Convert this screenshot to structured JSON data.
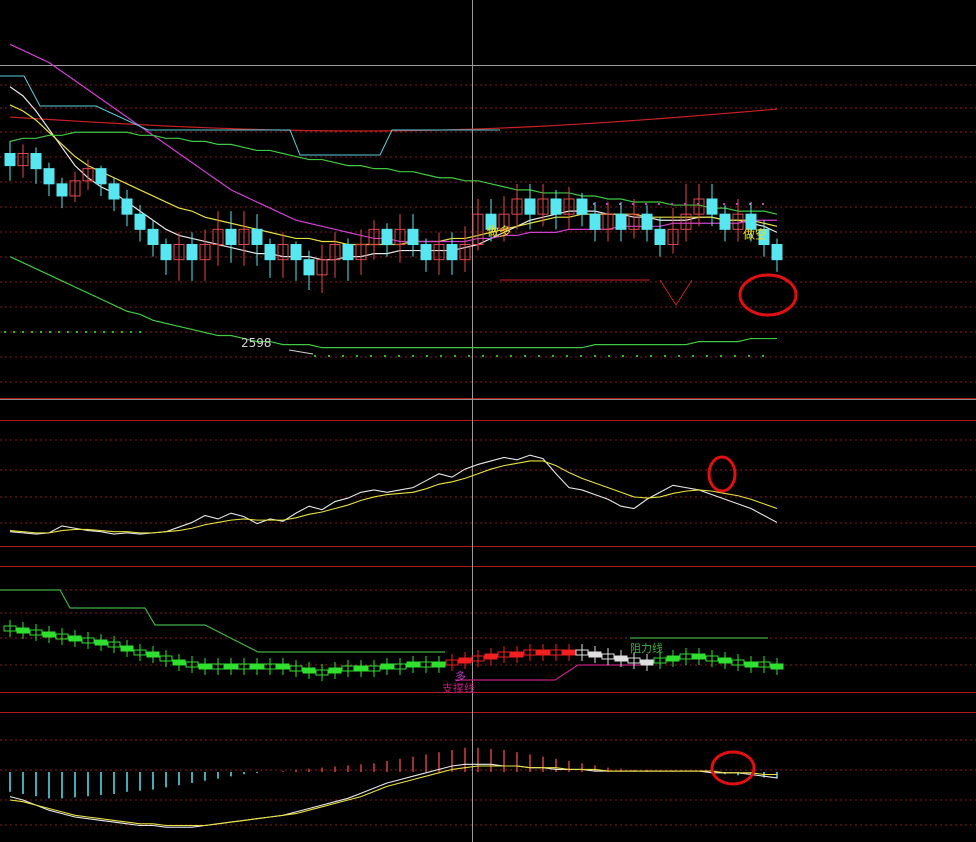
{
  "colors": {
    "background": "#000000",
    "grid_dotted": "#8a1a1a",
    "panel_border": "#b01818",
    "crosshair": "#9a9a9a",
    "bull_candle": "#e04848",
    "bear_candle": "#58e6f0",
    "ma_white": "#e8e8e8",
    "ma_yellow": "#e8e040",
    "ma_magenta": "#d040d0",
    "ma_green": "#40c840",
    "band_red": "#c82020",
    "dot_green": "#20c020",
    "dot_magenta": "#c040c0",
    "label_yellow": "#f0e020",
    "label_white": "#d0d0d0",
    "circle_red": "#e01010",
    "block_green": "#30e030",
    "block_red": "#f02020",
    "block_white": "#e0e0e0",
    "resist_green": "#40b040",
    "support_magenta": "#c02080",
    "hist_cyan": "#58e6f0",
    "hist_red": "#d04040"
  },
  "chart_data": [
    {
      "id": "main",
      "type": "candlestick",
      "annotations": [
        {
          "text": "做多",
          "series_index": 37
        },
        {
          "text": "做空",
          "series_index": 57
        },
        {
          "text": "2598",
          "series_index": 17
        }
      ],
      "candles": [
        {
          "o": 74,
          "c": 70,
          "h": 78,
          "l": 65
        },
        {
          "o": 70,
          "c": 74,
          "h": 77,
          "l": 66
        },
        {
          "o": 74,
          "c": 69,
          "h": 76,
          "l": 64
        },
        {
          "o": 69,
          "c": 64,
          "h": 71,
          "l": 60
        },
        {
          "o": 64,
          "c": 60,
          "h": 66,
          "l": 56
        },
        {
          "o": 60,
          "c": 65,
          "h": 68,
          "l": 58
        },
        {
          "o": 65,
          "c": 69,
          "h": 72,
          "l": 62
        },
        {
          "o": 69,
          "c": 64,
          "h": 70,
          "l": 60
        },
        {
          "o": 64,
          "c": 59,
          "h": 66,
          "l": 55
        },
        {
          "o": 59,
          "c": 54,
          "h": 62,
          "l": 50
        },
        {
          "o": 54,
          "c": 49,
          "h": 57,
          "l": 45
        },
        {
          "o": 49,
          "c": 44,
          "h": 52,
          "l": 40
        },
        {
          "o": 44,
          "c": 39,
          "h": 46,
          "l": 34
        },
        {
          "o": 39,
          "c": 44,
          "h": 48,
          "l": 32
        },
        {
          "o": 44,
          "c": 39,
          "h": 48,
          "l": 32
        },
        {
          "o": 39,
          "c": 44,
          "h": 49,
          "l": 32
        },
        {
          "o": 44,
          "c": 49,
          "h": 55,
          "l": 37
        },
        {
          "o": 49,
          "c": 44,
          "h": 55,
          "l": 38
        },
        {
          "o": 44,
          "c": 49,
          "h": 55,
          "l": 37
        },
        {
          "o": 49,
          "c": 44,
          "h": 54,
          "l": 37
        },
        {
          "o": 44,
          "c": 39,
          "h": 46,
          "l": 33
        },
        {
          "o": 39,
          "c": 44,
          "h": 48,
          "l": 33
        },
        {
          "o": 44,
          "c": 39,
          "h": 45,
          "l": 32
        },
        {
          "o": 39,
          "c": 34,
          "h": 42,
          "l": 29
        },
        {
          "o": 34,
          "c": 39,
          "h": 44,
          "l": 28
        },
        {
          "o": 39,
          "c": 44,
          "h": 48,
          "l": 33
        },
        {
          "o": 44,
          "c": 39,
          "h": 46,
          "l": 32
        },
        {
          "o": 39,
          "c": 44,
          "h": 49,
          "l": 34
        },
        {
          "o": 44,
          "c": 49,
          "h": 52,
          "l": 39
        },
        {
          "o": 49,
          "c": 44,
          "h": 51,
          "l": 40
        },
        {
          "o": 44,
          "c": 49,
          "h": 54,
          "l": 38
        },
        {
          "o": 49,
          "c": 44,
          "h": 54,
          "l": 40
        },
        {
          "o": 44,
          "c": 39,
          "h": 46,
          "l": 35
        },
        {
          "o": 39,
          "c": 44,
          "h": 48,
          "l": 34
        },
        {
          "o": 44,
          "c": 39,
          "h": 48,
          "l": 34
        },
        {
          "o": 39,
          "c": 44,
          "h": 50,
          "l": 35
        },
        {
          "o": 44,
          "c": 54,
          "h": 59,
          "l": 42
        },
        {
          "o": 54,
          "c": 49,
          "h": 59,
          "l": 45
        },
        {
          "o": 49,
          "c": 54,
          "h": 60,
          "l": 45
        },
        {
          "o": 54,
          "c": 59,
          "h": 64,
          "l": 49
        },
        {
          "o": 59,
          "c": 54,
          "h": 64,
          "l": 49
        },
        {
          "o": 54,
          "c": 59,
          "h": 64,
          "l": 50
        },
        {
          "o": 59,
          "c": 54,
          "h": 62,
          "l": 49
        },
        {
          "o": 54,
          "c": 59,
          "h": 63,
          "l": 49
        },
        {
          "o": 59,
          "c": 54,
          "h": 61,
          "l": 50
        },
        {
          "o": 54,
          "c": 49,
          "h": 58,
          "l": 45
        },
        {
          "o": 49,
          "c": 54,
          "h": 58,
          "l": 45
        },
        {
          "o": 54,
          "c": 49,
          "h": 58,
          "l": 45
        },
        {
          "o": 49,
          "c": 54,
          "h": 59,
          "l": 46
        },
        {
          "o": 54,
          "c": 49,
          "h": 57,
          "l": 45
        },
        {
          "o": 49,
          "c": 44,
          "h": 53,
          "l": 40
        },
        {
          "o": 44,
          "c": 49,
          "h": 56,
          "l": 41
        },
        {
          "o": 49,
          "c": 54,
          "h": 64,
          "l": 45
        },
        {
          "o": 54,
          "c": 59,
          "h": 64,
          "l": 50
        },
        {
          "o": 59,
          "c": 54,
          "h": 64,
          "l": 50
        },
        {
          "o": 54,
          "c": 49,
          "h": 57,
          "l": 45
        },
        {
          "o": 49,
          "c": 54,
          "h": 59,
          "l": 45
        },
        {
          "o": 54,
          "c": 49,
          "h": 58,
          "l": 45
        },
        {
          "o": 49,
          "c": 44,
          "h": 52,
          "l": 40
        },
        {
          "o": 44,
          "c": 39,
          "h": 46,
          "l": 35
        }
      ],
      "lines": [
        {
          "color": "ma_white",
          "values": [
            96,
            93,
            88,
            82,
            76,
            70,
            66,
            63,
            61,
            58,
            55,
            52,
            49,
            47,
            46,
            45,
            44,
            43,
            42,
            41,
            41,
            40,
            40,
            40,
            39,
            39,
            40,
            40,
            41,
            41,
            42,
            42,
            42,
            42,
            42,
            43,
            44,
            46,
            48,
            50,
            52,
            53,
            54,
            55,
            55,
            55,
            54,
            54,
            53,
            53,
            52,
            52,
            52,
            53,
            53,
            52,
            52,
            51,
            50,
            48
          ]
        },
        {
          "color": "ma_yellow",
          "values": [
            90,
            88,
            85,
            81,
            77,
            73,
            70,
            68,
            66,
            64,
            62,
            60,
            58,
            56,
            55,
            53,
            52,
            51,
            50,
            49,
            48,
            47,
            46,
            46,
            45,
            45,
            44,
            44,
            44,
            44,
            44,
            45,
            45,
            45,
            46,
            46,
            47,
            48,
            49,
            50,
            51,
            52,
            53,
            53,
            54,
            54,
            54,
            54,
            54,
            53,
            53,
            53,
            53,
            53,
            53,
            52,
            52,
            52,
            51,
            50
          ]
        },
        {
          "color": "ma_magenta",
          "values": [
            110,
            108,
            106,
            104,
            101,
            98,
            95,
            92,
            89,
            86,
            83,
            80,
            77,
            74,
            71,
            68,
            65,
            62,
            60,
            58,
            56,
            54,
            52,
            51,
            50,
            49,
            48,
            47,
            46,
            46,
            45,
            45,
            45,
            45,
            45,
            45,
            46,
            46,
            47,
            47,
            48,
            48,
            48,
            49,
            49,
            49,
            49,
            50,
            50,
            50,
            50,
            51,
            51,
            51,
            51,
            51,
            51,
            52,
            52,
            52
          ]
        },
        {
          "color": "ma_green",
          "values": [
            78,
            79,
            79,
            80,
            80,
            81,
            81,
            81,
            81,
            81,
            80,
            80,
            79,
            79,
            78,
            78,
            77,
            77,
            76,
            75,
            75,
            74,
            73,
            72,
            72,
            71,
            70,
            70,
            69,
            69,
            68,
            68,
            67,
            66,
            66,
            65,
            65,
            64,
            63,
            62,
            62,
            61,
            61,
            61,
            60,
            60,
            59,
            59,
            58,
            58,
            58,
            57,
            57,
            57,
            56,
            56,
            55,
            55,
            55,
            54
          ]
        },
        {
          "color": "ma_green",
          "values": [
            40,
            38,
            36,
            34,
            32,
            30,
            28,
            26,
            24,
            22,
            21,
            19,
            18,
            17,
            16,
            15,
            14,
            14,
            13,
            12,
            12,
            11,
            11,
            11,
            10,
            10,
            10,
            10,
            10,
            10,
            10,
            10,
            10,
            10,
            10,
            10,
            10,
            10,
            10,
            10,
            10,
            10,
            10,
            10,
            10,
            11,
            11,
            11,
            11,
            11,
            11,
            11,
            11,
            12,
            12,
            12,
            12,
            13,
            13,
            13
          ]
        }
      ],
      "y_range": [
        0,
        118
      ]
    },
    {
      "id": "oscillator",
      "type": "line",
      "series": [
        {
          "color": "ma_white",
          "values": [
            8,
            7,
            6,
            7,
            13,
            11,
            9,
            8,
            6,
            7,
            6,
            7,
            8,
            12,
            16,
            22,
            19,
            24,
            21,
            15,
            19,
            17,
            24,
            30,
            27,
            34,
            37,
            42,
            44,
            42,
            44,
            46,
            52,
            58,
            55,
            62,
            66,
            69,
            72,
            70,
            74,
            71,
            58,
            46,
            44,
            40,
            36,
            30,
            28,
            36,
            42,
            48,
            46,
            44,
            40,
            36,
            32,
            28,
            22,
            16
          ]
        },
        {
          "color": "ma_yellow",
          "values": [
            9,
            8,
            7,
            7,
            9,
            10,
            10,
            9,
            8,
            8,
            7,
            7,
            8,
            9,
            11,
            14,
            16,
            18,
            19,
            18,
            18,
            18,
            20,
            23,
            25,
            28,
            31,
            35,
            38,
            40,
            41,
            42,
            45,
            49,
            51,
            54,
            58,
            62,
            65,
            67,
            69,
            69,
            65,
            59,
            54,
            50,
            46,
            42,
            38,
            37,
            38,
            41,
            43,
            44,
            43,
            41,
            39,
            36,
            32,
            28
          ]
        }
      ],
      "y_range": [
        0,
        100
      ]
    },
    {
      "id": "blocks",
      "type": "bar",
      "annotations": [
        {
          "text": "阻力线",
          "series_index": 47
        },
        {
          "text": "支撑线",
          "series_index": 33
        },
        {
          "text": "多",
          "series_index": 33
        }
      ]
    },
    {
      "id": "histogram",
      "type": "bar",
      "values": [
        -18,
        -20,
        -22,
        -24,
        -24,
        -23,
        -22,
        -21,
        -20,
        -18,
        -17,
        -16,
        -14,
        -12,
        -10,
        -8,
        -6,
        -4,
        -2,
        -1,
        0,
        1,
        2,
        3,
        4,
        5,
        6,
        7,
        8,
        10,
        12,
        14,
        16,
        18,
        20,
        22,
        22,
        21,
        20,
        18,
        16,
        14,
        12,
        10,
        8,
        6,
        4,
        3,
        2,
        2,
        1,
        1,
        0,
        0,
        -1,
        -2,
        -3,
        -4,
        -5,
        -6
      ],
      "lines": [
        {
          "color": "ma_white",
          "values": [
            22,
            20,
            17,
            14,
            12,
            10,
            9,
            8,
            7,
            6,
            5,
            5,
            4,
            4,
            4,
            5,
            6,
            7,
            8,
            9,
            10,
            11,
            13,
            15,
            17,
            19,
            21,
            24,
            27,
            30,
            32,
            34,
            36,
            38,
            40,
            41,
            41,
            41,
            40,
            40,
            39,
            39,
            38,
            38,
            38,
            37,
            37,
            37,
            37,
            37,
            37,
            37,
            37,
            37,
            36,
            36,
            36,
            35,
            34,
            33
          ]
        },
        {
          "color": "ma_yellow",
          "values": [
            20,
            19,
            17,
            15,
            13,
            11,
            10,
            9,
            8,
            7,
            6,
            6,
            5,
            5,
            5,
            5,
            6,
            7,
            8,
            9,
            10,
            11,
            12,
            14,
            16,
            18,
            20,
            22,
            25,
            28,
            30,
            32,
            34,
            36,
            38,
            39,
            40,
            40,
            40,
            40,
            39,
            39,
            39,
            38,
            38,
            38,
            37,
            37,
            37,
            37,
            37,
            37,
            37,
            37,
            37,
            36,
            36,
            36,
            35,
            35
          ]
        }
      ],
      "y_range": [
        -30,
        50
      ]
    }
  ]
}
